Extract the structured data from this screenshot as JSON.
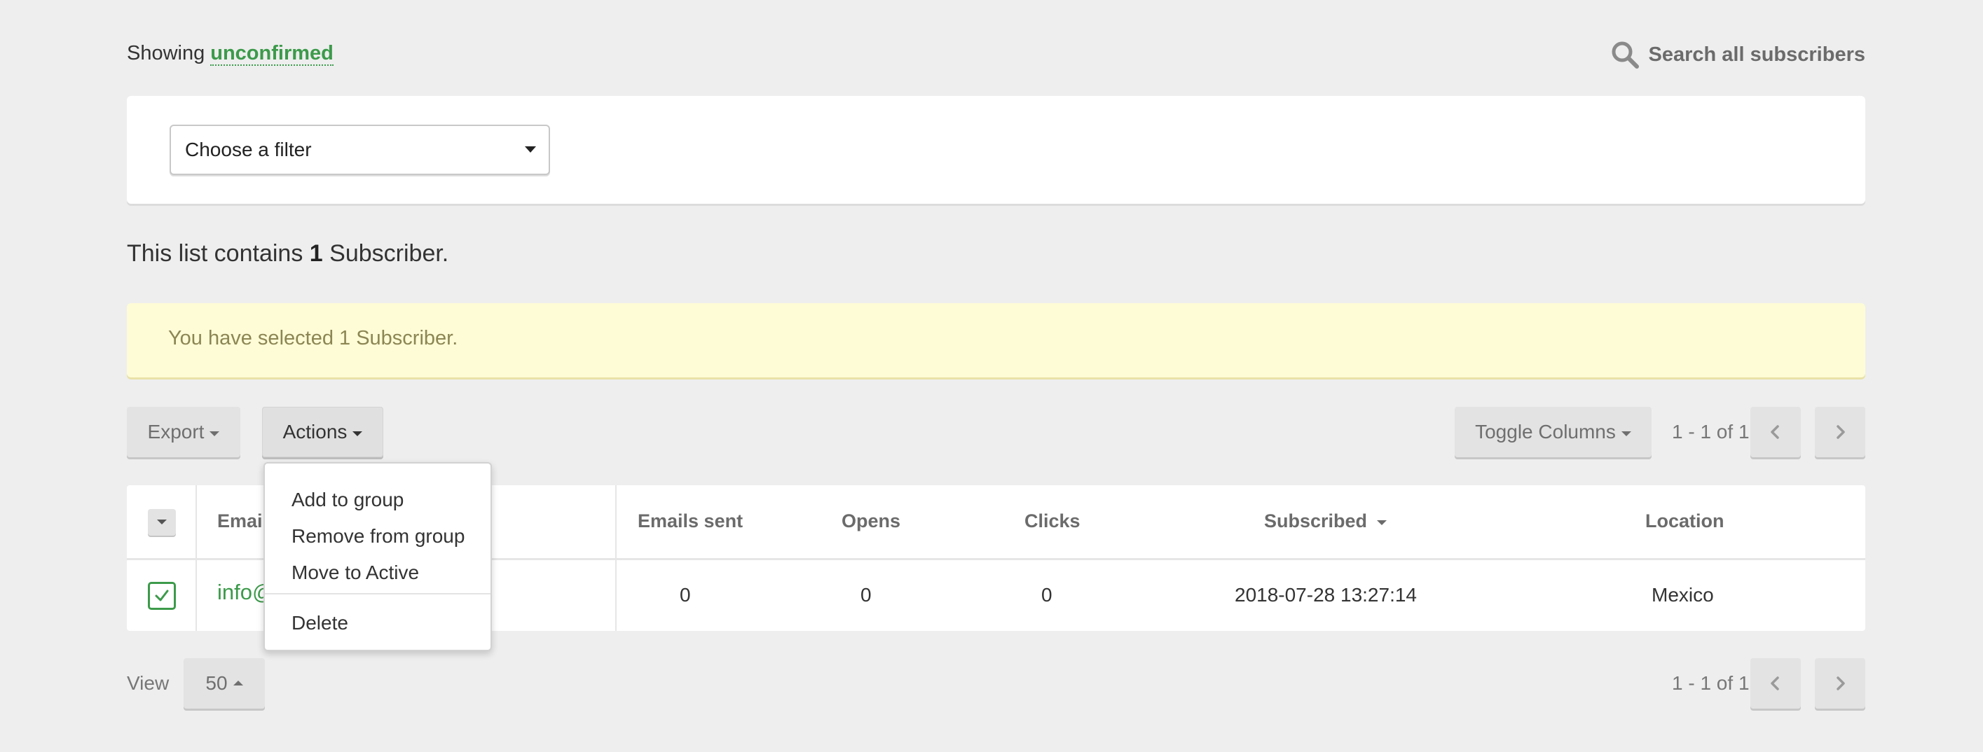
{
  "header": {
    "showing_label": "Showing",
    "showing_filter": "unconfirmed",
    "search_label": "Search all subscribers"
  },
  "filter": {
    "select_value": "Choose a filter"
  },
  "summary": {
    "prefix": "This list contains",
    "count": "1",
    "suffix": "Subscriber."
  },
  "notice": {
    "text": "You have selected 1 Subscriber."
  },
  "toolbar": {
    "export_label": "Export",
    "actions_label": "Actions",
    "toggle_columns_label": "Toggle Columns",
    "pager_text": "1 - 1 of 1"
  },
  "actions_menu": {
    "items": [
      "Add to group",
      "Remove from group",
      "Move to Active"
    ],
    "danger_item": "Delete"
  },
  "table": {
    "columns": {
      "email": "Email",
      "emails_sent": "Emails sent",
      "opens": "Opens",
      "clicks": "Clicks",
      "subscribed": "Subscribed",
      "location": "Location"
    },
    "rows": [
      {
        "email": "info@",
        "emails_sent": "0",
        "opens": "0",
        "clicks": "0",
        "subscribed": "2018-07-28 13:27:14",
        "location": "Mexico",
        "selected": true
      }
    ]
  },
  "footer": {
    "view_label": "View",
    "per_page": "50",
    "pager_text": "1 - 1 of 1"
  },
  "colors": {
    "accent_green": "#3c9a4a",
    "notice_bg": "#fefcd6",
    "page_bg": "#eeeeee"
  }
}
